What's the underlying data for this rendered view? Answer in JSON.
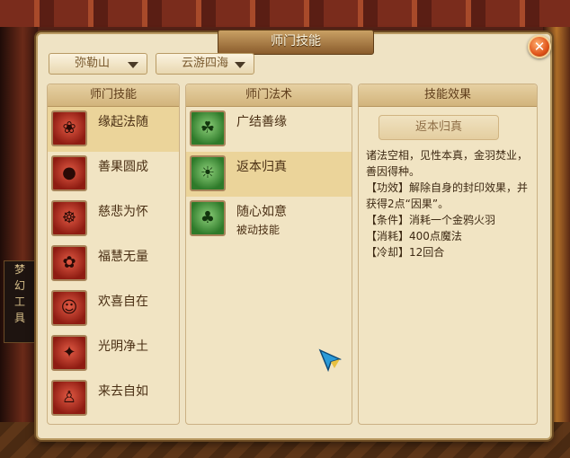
{
  "scene": {
    "side_text": "梦\n幻\n工\n具"
  },
  "window": {
    "title": "师门技能",
    "close_glyph": "✕"
  },
  "filters": {
    "school": "弥勒山",
    "mode": "云游四海"
  },
  "panels": {
    "skills_header": "师门技能",
    "spells_header": "师门法术",
    "effect_header": "技能效果"
  },
  "skills": [
    {
      "label": "缘起法随",
      "icon": "lotus-figure-icon",
      "glyph": "❀"
    },
    {
      "label": "善果圆成",
      "icon": "fruit-icon",
      "glyph": "●"
    },
    {
      "label": "慈悲为怀",
      "icon": "hands-icon",
      "glyph": "☸"
    },
    {
      "label": "福慧无量",
      "icon": "flower-icon",
      "glyph": "✿"
    },
    {
      "label": "欢喜自在",
      "icon": "buddha-icon",
      "glyph": "☺"
    },
    {
      "label": "光明净土",
      "icon": "flame-icon",
      "glyph": "✦"
    },
    {
      "label": "来去自如",
      "icon": "monk-icon",
      "glyph": "♙"
    }
  ],
  "spells": [
    {
      "label": "广结善缘",
      "icon": "figures-icon",
      "glyph": "☘",
      "sub": ""
    },
    {
      "label": "返本归真",
      "icon": "sun-figure-icon",
      "glyph": "☀",
      "sub": ""
    },
    {
      "label": "随心如意",
      "icon": "tree-icon",
      "glyph": "♣",
      "sub": "被动技能"
    }
  ],
  "effect": {
    "name": "返本归真",
    "description": "诸法空相，见性本真，金羽焚业，善因得种。",
    "function": "【功效】解除自身的封印效果，并获得2点“因果”。",
    "condition": "【条件】消耗一个金鸦火羽",
    "cost": "【消耗】400点魔法",
    "cooldown": "【冷却】12回合"
  },
  "colors": {
    "accent": "#e0541a",
    "panel": "#f1e4c3",
    "selected": "#ebd49a"
  }
}
